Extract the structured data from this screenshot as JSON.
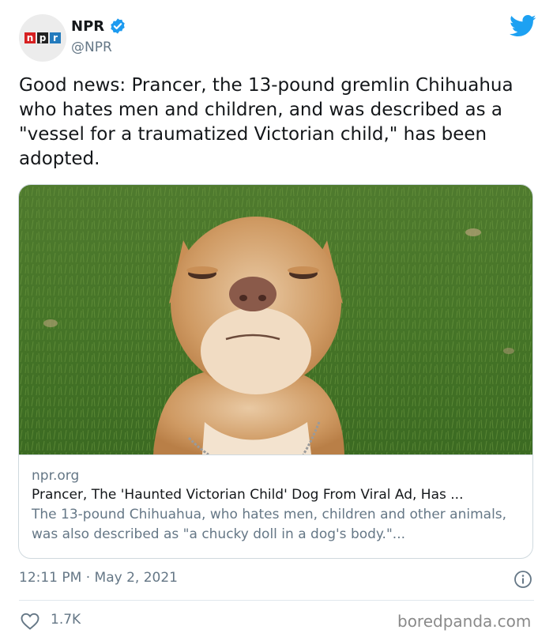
{
  "author": {
    "logo_letters": [
      "n",
      "p",
      "r"
    ],
    "display_name": "NPR",
    "verified": true,
    "handle": "@NPR",
    "avatar_icon": "npr-logo-icon"
  },
  "tweet": {
    "text": "Good news: Prancer, the 13-pound gremlin Chihuahua who hates men and children, and was described as a \"vessel for a traumatized Victorian child,\" has been adopted.",
    "timestamp": "12:11 PM · May 2, 2021",
    "likes": "1.7K"
  },
  "link_card": {
    "image_subject": "chihuahua-on-grass",
    "domain": "npr.org",
    "title": "Prancer, The 'Haunted Victorian Child' Dog From Viral Ad, Has ...",
    "description": "The 13-pound Chihuahua, who hates men, children and other animals, was also described as \"a chucky doll in a dog's body.\"..."
  },
  "watermark": "boredpanda.com",
  "colors": {
    "twitter_blue": "#1da1f2",
    "verified_blue": "#1d9bf0",
    "secondary_text": "#657786",
    "npr_red": "#d62021",
    "npr_blue": "#237bbd"
  }
}
